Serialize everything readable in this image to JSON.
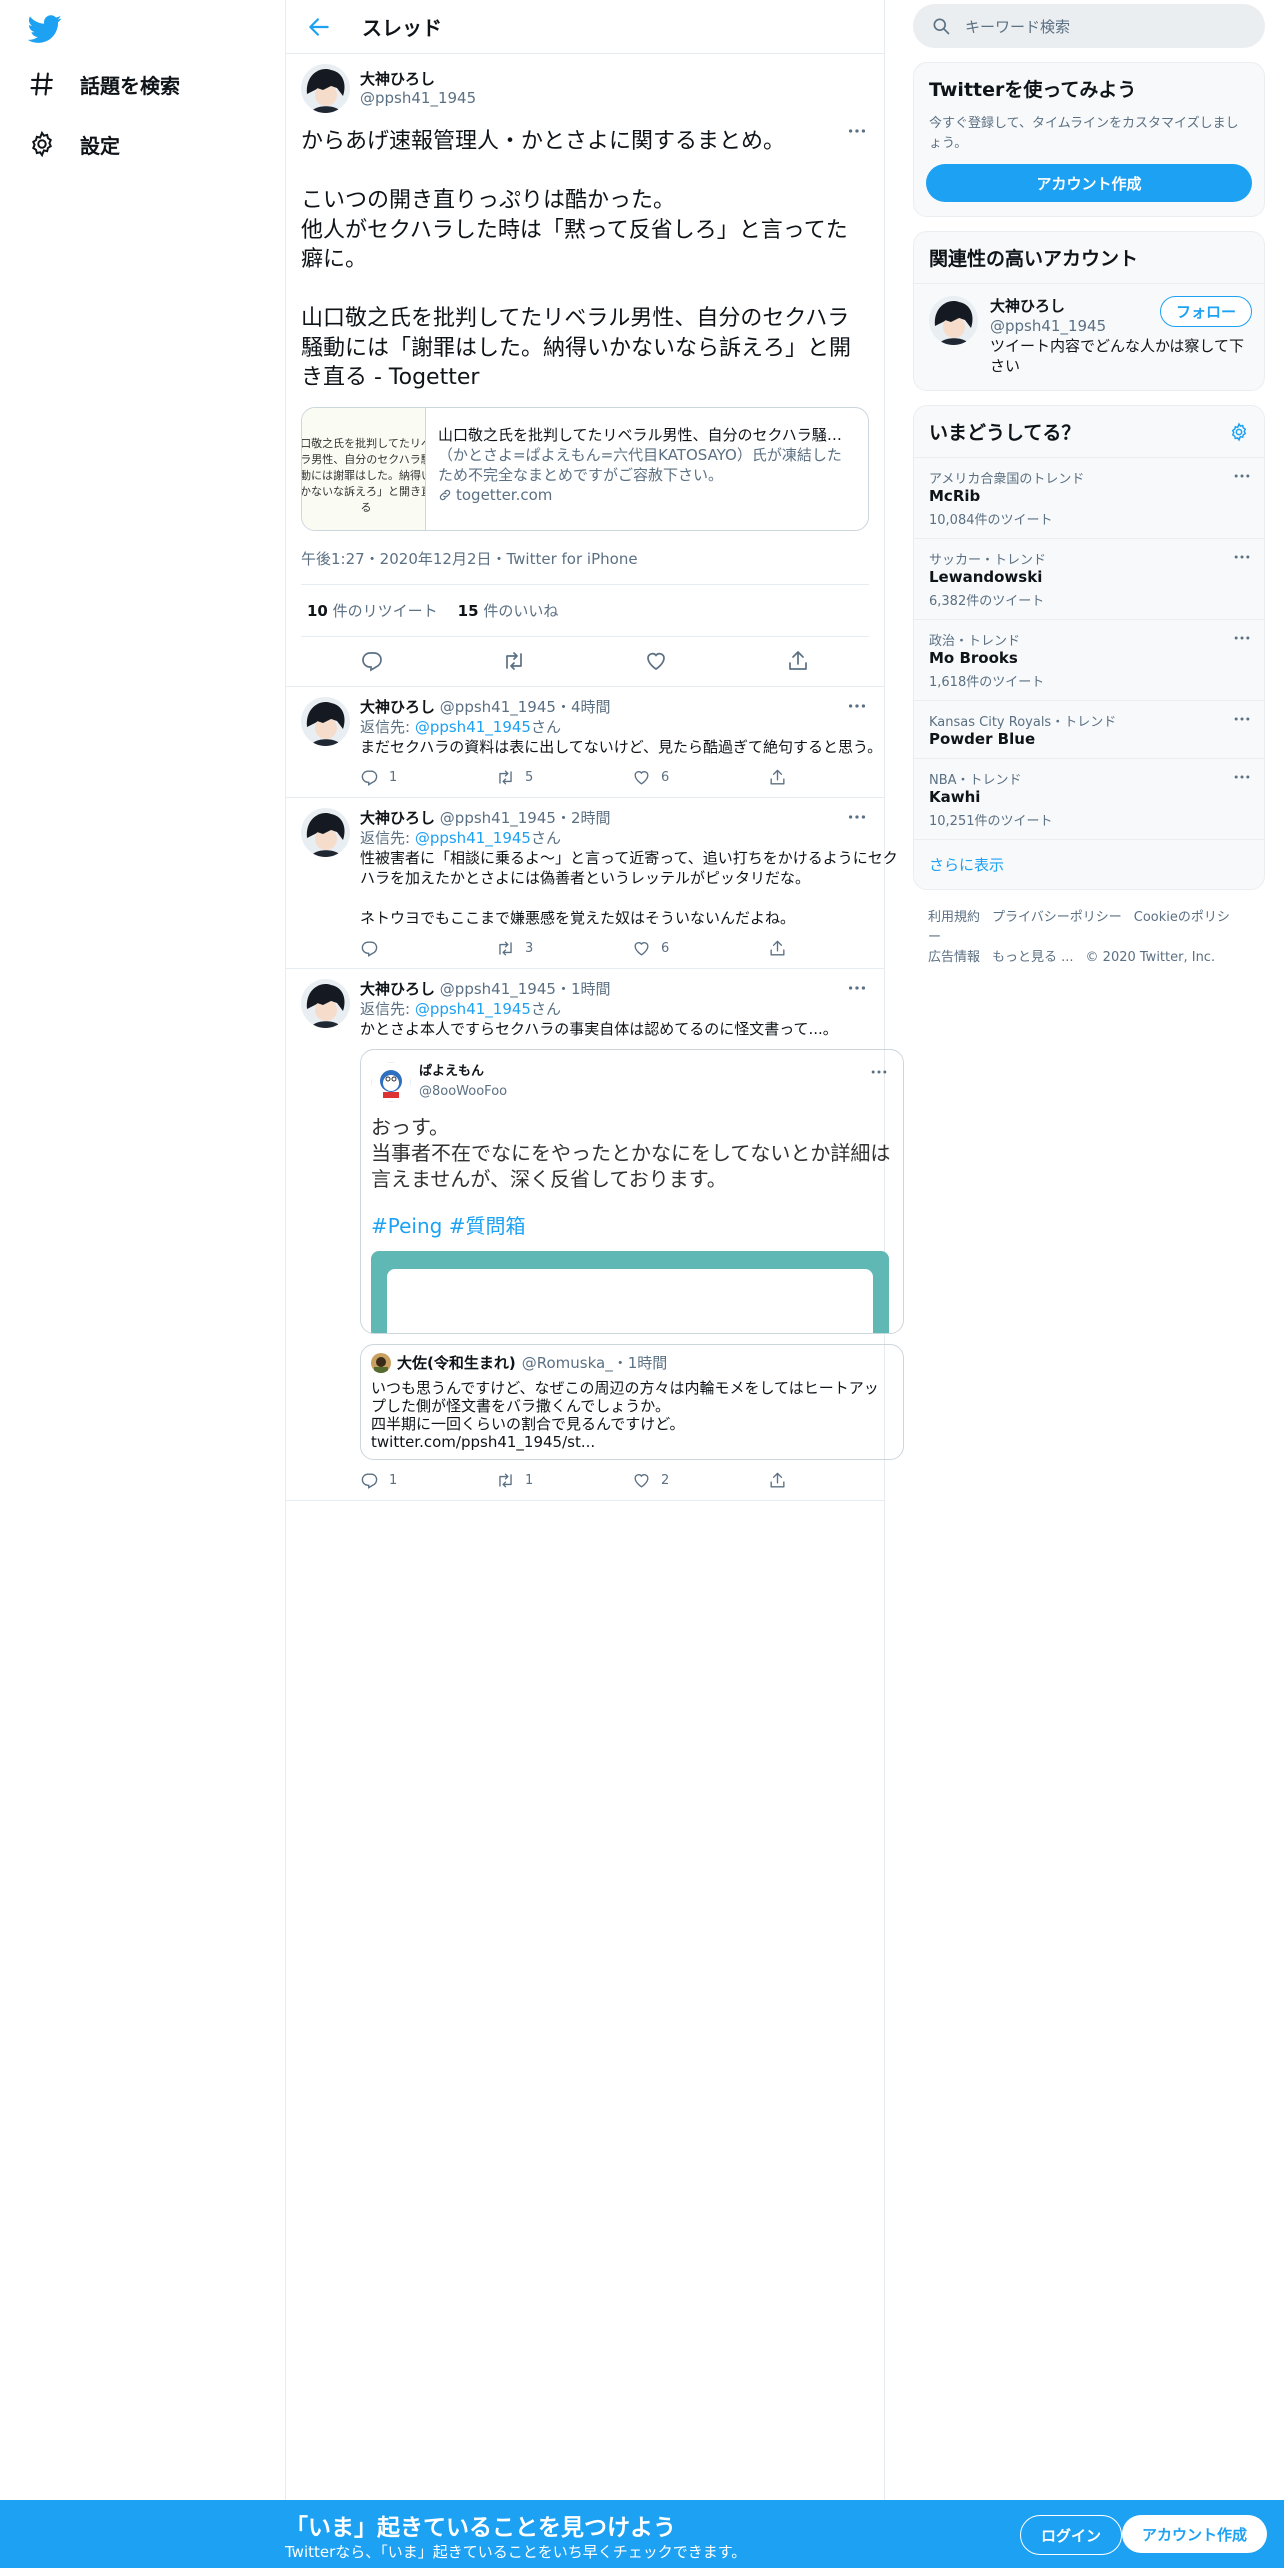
{
  "nav": {
    "explore_label": "話題を検索",
    "settings_label": "設定"
  },
  "header": {
    "title": "スレッド"
  },
  "main_tweet": {
    "name": "大神ひろし",
    "handle": "@ppsh41_1945",
    "text": "からあげ速報管理人・かとさよに関するまとめ。\n\nこいつの開き直りっぷりは酷かった。\n他人がセクハラした時は「黙って反省しろ」と言ってた癖に。\n\n山口敬之氏を批判してたリベラル男性、自分のセクハラ騒動には「謝罪はした。納得いかないなら訴えろ」と開き直る - Togetter",
    "card": {
      "thumb_text": "口敬之氏を批判してたリベラ男性、自分のセクハラ騒動には謝罪はした。納得いかないな訴えろ」と開き直る",
      "title": "山口敬之氏を批判してたリベラル男性、自分のセクハラ騒動...",
      "desc": "（かとさよ=ぱよえもん=六代目KATOSAYO）氏が凍結したため不完全なまとめですがご容赦下さい。",
      "domain": "togetter.com"
    },
    "timestamp": "午後1:27・2020年12月2日・Twitter for iPhone",
    "retweets": "10",
    "retweets_label": "件のリツイート",
    "likes": "15",
    "likes_label": "件のいいね"
  },
  "replies": [
    {
      "name": "大神ひろし",
      "handle": "@ppsh41_1945",
      "time": "・4時間",
      "reply_to_label": "返信先: ",
      "reply_to": "@ppsh41_1945",
      "reply_to_suffix": "さん",
      "text": "まだセクハラの資料は表に出してないけど、見たら酷過ぎて絶句すると思う。",
      "reply_count": "1",
      "retweet_count": "5",
      "like_count": "6"
    },
    {
      "name": "大神ひろし",
      "handle": "@ppsh41_1945",
      "time": "・2時間",
      "reply_to_label": "返信先: ",
      "reply_to": "@ppsh41_1945",
      "reply_to_suffix": "さん",
      "text": "性被害者に「相談に乗るよ～」と言って近寄って、追い打ちをかけるようにセクハラを加えたかとさよには偽善者というレッテルがピッタリだな。\n\nネトウヨでもここまで嫌悪感を覚えた奴はそういないんだよね。",
      "reply_count": "",
      "retweet_count": "3",
      "like_count": "6"
    },
    {
      "name": "大神ひろし",
      "handle": "@ppsh41_1945",
      "time": "・1時間",
      "reply_to_label": "返信先: ",
      "reply_to": "@ppsh41_1945",
      "reply_to_suffix": "さん",
      "text": "かとさよ本人ですらセクハラの事実自体は認めてるのに怪文書って...。",
      "quote1": {
        "name": "ぱよえもん",
        "handle": "@8ooWooFoo",
        "text": "おっす。\n当事者不在でなにをやったとかなにをしてないとか詳細は言えませんが、深く反省しております。",
        "tags": "#Peing #質問箱"
      },
      "quote2": {
        "name": "大佐(令和生まれ)",
        "handle": "@Romuska_",
        "time": "・1時間",
        "text": "いつも思うんですけど、なぜこの周辺の方々は内輪モメをしてはヒートアップした側が怪文書をバラ撒くんでしょうか。\n四半期に一回くらいの割合で見るんですけど。\ntwitter.com/ppsh41_1945/st..."
      },
      "reply_count": "1",
      "retweet_count": "1",
      "like_count": "2"
    }
  ],
  "sidebar": {
    "search_placeholder": "キーワード検索",
    "signup": {
      "title": "Twitterを使ってみよう",
      "desc": "今すぐ登録して、タイムラインをカスタマイズしましょう。",
      "button": "アカウント作成"
    },
    "related": {
      "title": "関連性の高いアカウント",
      "name": "大神ひろし",
      "handle": "@ppsh41_1945",
      "bio": "ツイート内容でどんな人かは察して下さい",
      "follow": "フォロー"
    },
    "trends": {
      "title": "いまどうしてる？",
      "items": [
        {
          "context": "アメリカ合衆国のトレンド",
          "name": "McRib",
          "count": "10,084件のツイート"
        },
        {
          "context": "サッカー・トレンド",
          "name": "Lewandowski",
          "count": "6,382件のツイート"
        },
        {
          "context": "政治・トレンド",
          "name": "Mo Brooks",
          "count": "1,618件のツイート"
        },
        {
          "context": "Kansas City Royals・トレンド",
          "name": "Powder Blue",
          "count": ""
        },
        {
          "context": "NBA・トレンド",
          "name": "Kawhi",
          "count": "10,251件のツイート"
        }
      ],
      "show_more": "さらに表示"
    },
    "footer": {
      "terms": "利用規約",
      "privacy": "プライバシーポリシー",
      "cookie": "Cookieのポリシー",
      "ads": "広告情報",
      "more": "もっと見る ...",
      "copyright": "© 2020 Twitter, Inc."
    }
  },
  "bottom_bar": {
    "headline": "「いま」起きていることを見つけよう",
    "subline": "Twitterなら、「いま」起きていることをいち早くチェックできます。",
    "login": "ログイン",
    "signup": "アカウント作成"
  },
  "colors": {
    "accent": "#1da1f2",
    "border": "#e6ecf0",
    "muted_text": "#5b7083"
  }
}
